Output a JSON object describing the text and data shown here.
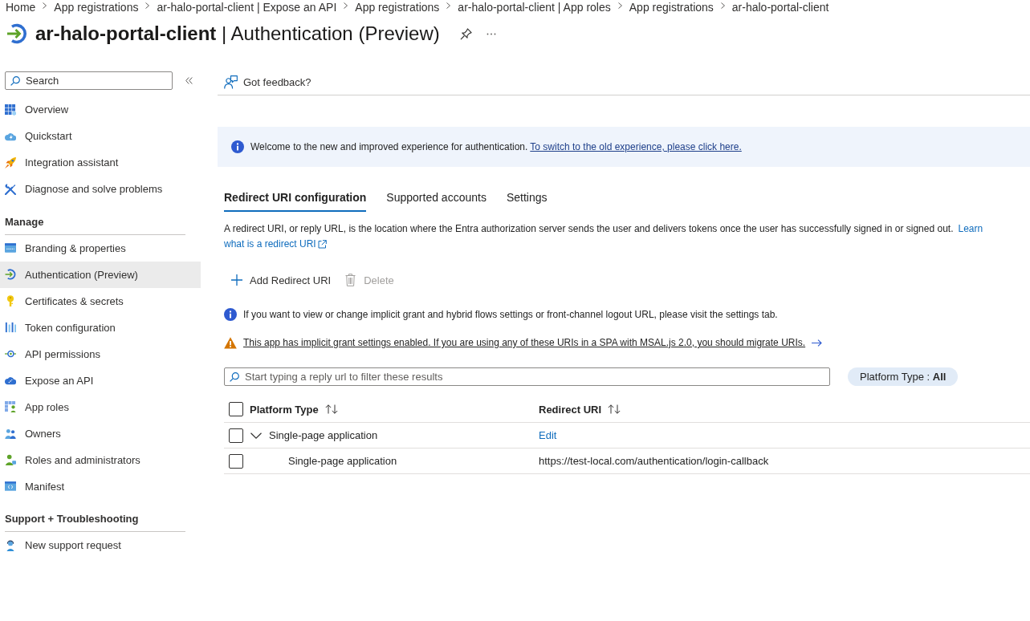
{
  "breadcrumb": [
    "Home",
    "App registrations",
    "ar-halo-portal-client | Expose an API",
    "App registrations",
    "ar-halo-portal-client | App roles",
    "App registrations",
    "ar-halo-portal-client"
  ],
  "page_title": "**ar-halo-portal-client** | Authentication (Preview)",
  "sidebar": {
    "search": {
      "placeholder": "Search"
    },
    "groups": [
      {
        "items": [
          {
            "label": "Overview",
            "selected": false
          },
          {
            "label": "Quickstart",
            "selected": false
          },
          {
            "label": "Integration assistant",
            "selected": false
          },
          {
            "label": "Diagnose and solve problems",
            "selected": false
          }
        ]
      },
      {
        "heading": "Manage",
        "items": [
          {
            "label": "Branding & properties",
            "selected": false
          },
          {
            "label": "Authentication (Preview)",
            "selected": true
          },
          {
            "label": "Certificates & secrets",
            "selected": false
          },
          {
            "label": "Token configuration",
            "selected": false
          },
          {
            "label": "API permissions",
            "selected": false
          },
          {
            "label": "Expose an API",
            "selected": false
          },
          {
            "label": "App roles",
            "selected": false
          },
          {
            "label": "Owners",
            "selected": false
          },
          {
            "label": "Roles and administrators",
            "selected": false
          },
          {
            "label": "Manifest",
            "selected": false
          }
        ]
      },
      {
        "heading": "Support + Troubleshooting",
        "items": [
          {
            "label": "New support request",
            "selected": false
          }
        ]
      }
    ]
  },
  "toolbar": {
    "feedback": "Got feedback?"
  },
  "banner": {
    "text": "Welcome to the new and improved experience for authentication.",
    "link": "To switch to the old experience, please click here."
  },
  "tabs": [
    {
      "label": "Redirect URI configuration",
      "selected": true
    },
    {
      "label": "Supported accounts",
      "selected": false
    },
    {
      "label": "Settings",
      "selected": false
    }
  ],
  "description": {
    "text": "A redirect URI, or reply URL, is the location where the Entra authorization server sends the user and delivers tokens once the user has successfully signed in or signed out.",
    "links": [
      "Learn",
      "what is a redirect URI"
    ]
  },
  "actions": [
    {
      "kind": "add",
      "label": "Add Redirect URI",
      "disabled": false
    },
    {
      "kind": "delete",
      "label": "Delete",
      "disabled": true
    }
  ],
  "notices": [
    {
      "kind": "info",
      "text": "If you want to view or change implicit grant and hybrid flows settings or front-channel logout URL, please visit the settings tab."
    },
    {
      "kind": "warning",
      "text": "This app has implicit grant settings enabled. If you are using any of these URIs in a SPA with MSAL.js 2.0, you should migrate URIs."
    }
  ],
  "filter": {
    "placeholder": "Start typing a reply url to filter these results"
  },
  "platform_filter": "Platform Type : **All**",
  "table": {
    "header_checked": false,
    "columns": [
      "Platform Type",
      "Redirect URI"
    ],
    "rows": [
      {
        "checked": false,
        "expanded": true,
        "platform_type": "Single-page application",
        "action": "Edit",
        "children": [
          {
            "checked": false,
            "platform_type": "Single-page application",
            "redirect_uri": "https://test-local.com/authentication/login-callback"
          }
        ]
      }
    ]
  }
}
